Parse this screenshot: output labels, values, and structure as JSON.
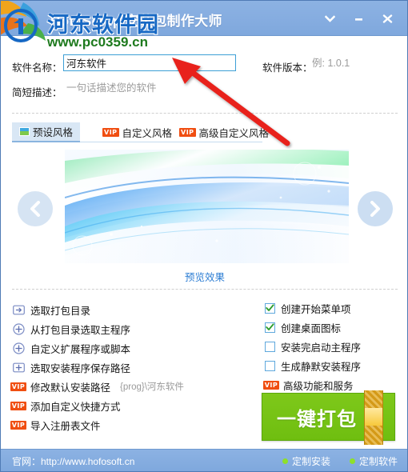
{
  "window": {
    "title": "HofoSetup 安装包制作大师",
    "controls": [
      {
        "name": "chevron-down",
        "label": "▾"
      },
      {
        "name": "minimize",
        "label": "—"
      },
      {
        "name": "close",
        "label": "✕"
      }
    ]
  },
  "form": {
    "name_label": "软件名称：",
    "name_value": "河东软件",
    "version_label": "软件版本：",
    "version_placeholder": "例: 1.0.1",
    "version_value": "",
    "desc_label": "简短描述：",
    "desc_placeholder": "一句话描述您的软件",
    "desc_value": ""
  },
  "tabs": [
    {
      "label": "预设风格",
      "badge": "",
      "icon": "style-swatch-icon",
      "active": true
    },
    {
      "label": "自定义风格",
      "badge": "VIP",
      "icon": "vip-badge-icon",
      "active": false
    },
    {
      "label": "高级自定义风格",
      "badge": "VIP",
      "icon": "vip-badge-icon",
      "active": false
    }
  ],
  "preview": {
    "link_label": "预览效果",
    "prev_label": "‹",
    "next_label": "›"
  },
  "left_options": [
    {
      "label": "选取打包目录",
      "icon": "folder-arrow-icon",
      "sub": ""
    },
    {
      "label": "从打包目录选取主程序",
      "icon": "plus-circle-icon",
      "sub": ""
    },
    {
      "label": "自定义扩展程序或脚本",
      "icon": "plus-circle-icon",
      "sub": ""
    },
    {
      "label": "选取安装程序保存路径",
      "icon": "folder-plus-icon",
      "sub": ""
    },
    {
      "label": "修改默认安装路径",
      "icon": "vip-badge-icon",
      "sub": "{prog}\\河东软件"
    },
    {
      "label": "添加自定义快捷方式",
      "icon": "vip-badge-icon",
      "sub": ""
    },
    {
      "label": "导入注册表文件",
      "icon": "vip-badge-icon",
      "sub": ""
    }
  ],
  "right_options": [
    {
      "label": "创建开始菜单项",
      "type": "checkbox",
      "checked": true
    },
    {
      "label": "创建桌面图标",
      "type": "checkbox",
      "checked": true
    },
    {
      "label": "安装完启动主程序",
      "type": "checkbox",
      "checked": false
    },
    {
      "label": "生成静默安装程序",
      "type": "checkbox",
      "checked": false
    },
    {
      "label": "高级功能和服务",
      "type": "vip",
      "checked": false
    }
  ],
  "pack_button": {
    "label": "一键打包"
  },
  "statusbar": {
    "site": "官网：http://www.hofosoft.cn",
    "items": [
      {
        "label": "定制安装"
      },
      {
        "label": "定制软件"
      }
    ]
  },
  "watermark": {
    "cn": "河东软件园",
    "url": "www.pc0359.cn"
  },
  "colors": {
    "titlebar": "#86ade0",
    "accent_blue": "#3d9fd6",
    "vip_orange": "#f04e11",
    "green_button": "#74c215",
    "link_blue": "#2f7fd4",
    "status_dot": "#8ee02a"
  }
}
